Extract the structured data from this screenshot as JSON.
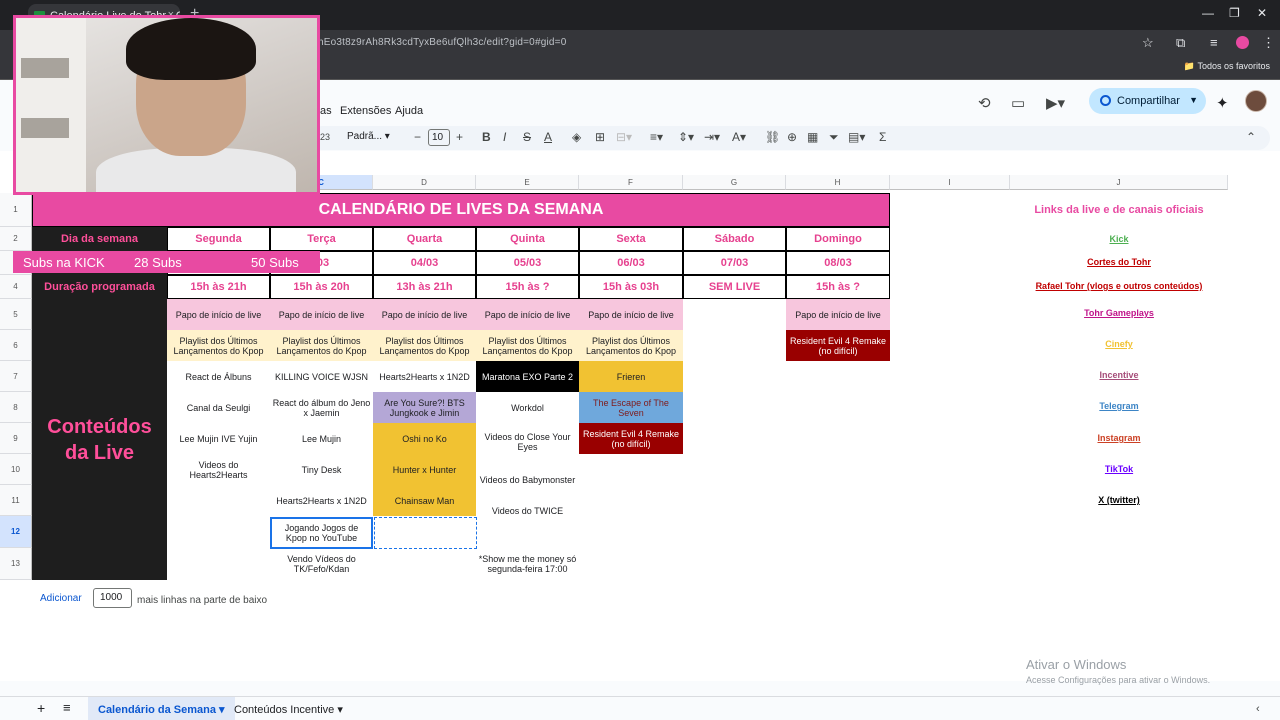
{
  "browser": {
    "tab_title": "Calendário Live do Tohr - Goo...",
    "tab_close": "×",
    "new_tab": "+",
    "url": "hEo3t8z9rAh8Rk3cdTyxBe6ufQlh3c/edit?gid=0#gid=0",
    "bookmarks_all": "Todos os favoritos"
  },
  "app": {
    "menus": [
      "as",
      "Extensões",
      "Ajuda"
    ],
    "share_label": "Compartilhar",
    "font_name": "Padrã...",
    "font_size": "10",
    "num_format": "23"
  },
  "sheet": {
    "columns": [
      "C",
      "D",
      "E",
      "F",
      "G",
      "H",
      "I",
      "J"
    ],
    "rows": [
      "1",
      "2",
      "3",
      "4",
      "5",
      "6",
      "7",
      "8",
      "9",
      "10",
      "11",
      "12",
      "13"
    ],
    "title": "CALENDÁRIO DE LIVES DA SEMANA",
    "row2_label": "Dia da semana",
    "row4_label": "Duração programada",
    "conteudos_label": "Conteúdos da Live",
    "days": [
      "Segunda",
      "Terça",
      "Quarta",
      "Quinta",
      "Sexta",
      "Sábado",
      "Domingo"
    ],
    "dates": [
      "",
      "/03",
      "04/03",
      "05/03",
      "06/03",
      "07/03",
      "08/03"
    ],
    "durations": [
      "15h às 21h",
      "15h às 20h",
      "13h às 21h",
      "15h às ?",
      "15h às 03h",
      "SEM LIVE",
      "15h às ?"
    ],
    "papo": "Papo de início de live",
    "playlist": "Playlist dos Últimos Lançamentos do Kpop",
    "cells": {
      "b7": "React de Álbuns",
      "b8": "Canal da Seulgi",
      "b9": "Lee Mujin IVE Yujin",
      "b10": "Videos do Hearts2Hearts",
      "c7": "KILLING VOICE WJSN",
      "c8": "React do álbum do Jeno x Jaemin",
      "c9": "Lee Mujin",
      "c10": "Tiny Desk",
      "c11": "Hearts2Hearts x 1N2D",
      "c12": "Jogando Jogos de Kpop no YouTube",
      "c13": "Vendo Vídeos do TK/Fefo/Kdan",
      "d7": "Hearts2Hearts x 1N2D",
      "d8": "Are You Sure?! BTS Jungkook e Jimin",
      "d9": "Oshi no Ko",
      "d10": "Hunter x Hunter",
      "d11": "Chainsaw Man",
      "e7": "Maratona EXO Parte 2",
      "e8": "Workdol",
      "e9": "Videos do Close Your Eyes",
      "e10": "Videos do Babymonster",
      "e11": "Videos do TWICE",
      "e13": "*Show me the money só segunda-feira 17:00",
      "f7": "Frieren",
      "f8": "The Escape of The Seven",
      "f9": "Resident Evil 4 Remake (no difícil)",
      "h6": "Resident Evil 4 Remake (no difícil)"
    },
    "links_title": "Links da live e de canais oficiais",
    "links": [
      {
        "text": "Kick",
        "color": "#4caf50"
      },
      {
        "text": "Cortes do Tohr",
        "color": "#c00000"
      },
      {
        "text": "Rafael Tohr (vlogs e outros conteúdos)",
        "color": "#c00000"
      },
      {
        "text": "Tohr Gameplays",
        "color": "#c0148a"
      },
      {
        "text": "Cinefy",
        "color": "#f1c232"
      },
      {
        "text": "Incentive",
        "color": "#a64d79"
      },
      {
        "text": "Telegram",
        "color": "#3d85c6"
      },
      {
        "text": "Instagram",
        "color": "#cc4125"
      },
      {
        "text": "TikTok",
        "color": "#6a00ff"
      },
      {
        "text": "X (twitter)",
        "color": "#000000"
      }
    ],
    "add_button": "Adicionar",
    "add_count": "1000",
    "add_text": "mais linhas na parte de baixo"
  },
  "sheet_tabs": [
    "Calendário da Semana",
    "Conteúdos Incentive"
  ],
  "overlay": {
    "subs_label": "Subs na KICK",
    "subs_current": "28 Subs",
    "subs_goal": "50 Subs"
  },
  "watermark": {
    "line1": "Ativar o Windows",
    "line2": "Acesse Configurações para ativar o Windows."
  }
}
